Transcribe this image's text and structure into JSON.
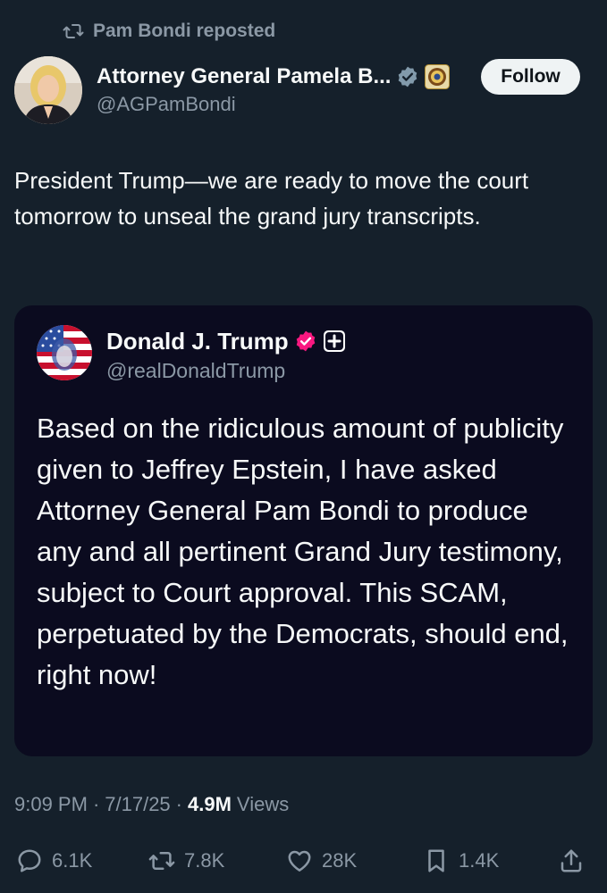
{
  "repost": {
    "label": "Pam Bondi reposted",
    "icon": "repost-icon"
  },
  "post": {
    "author_name": "Attorney General Pamela B...",
    "handle": "@AGPamBondi",
    "follow_label": "Follow",
    "text": "President Trump—we are ready to move the court tomorrow to unseal the grand jury transcripts."
  },
  "quote": {
    "author_name": "Donald J. Trump",
    "handle": "@realDonaldTrump",
    "text": "Based on the ridiculous amount of publicity given to Jeffrey Epstein, I have asked Attorney General Pam Bondi to produce any and all pertinent Grand Jury testimony, subject to Court approval. This SCAM, perpetuated by the Democrats, should end, right now!"
  },
  "meta": {
    "time": "9:09 PM",
    "separator": "·",
    "date": "7/17/25",
    "views_count": "4.9M",
    "views_label": "Views"
  },
  "actions": {
    "replies": "6.1K",
    "reposts": "7.8K",
    "likes": "28K",
    "bookmarks": "1.4K"
  },
  "colors": {
    "background": "#15202b",
    "quote_background": "#0b0b1f",
    "muted_text": "#8b98a5",
    "verified_blue": "#1d9bf0",
    "verified_grey": "#829aab",
    "pink_badge": "#f91880"
  }
}
